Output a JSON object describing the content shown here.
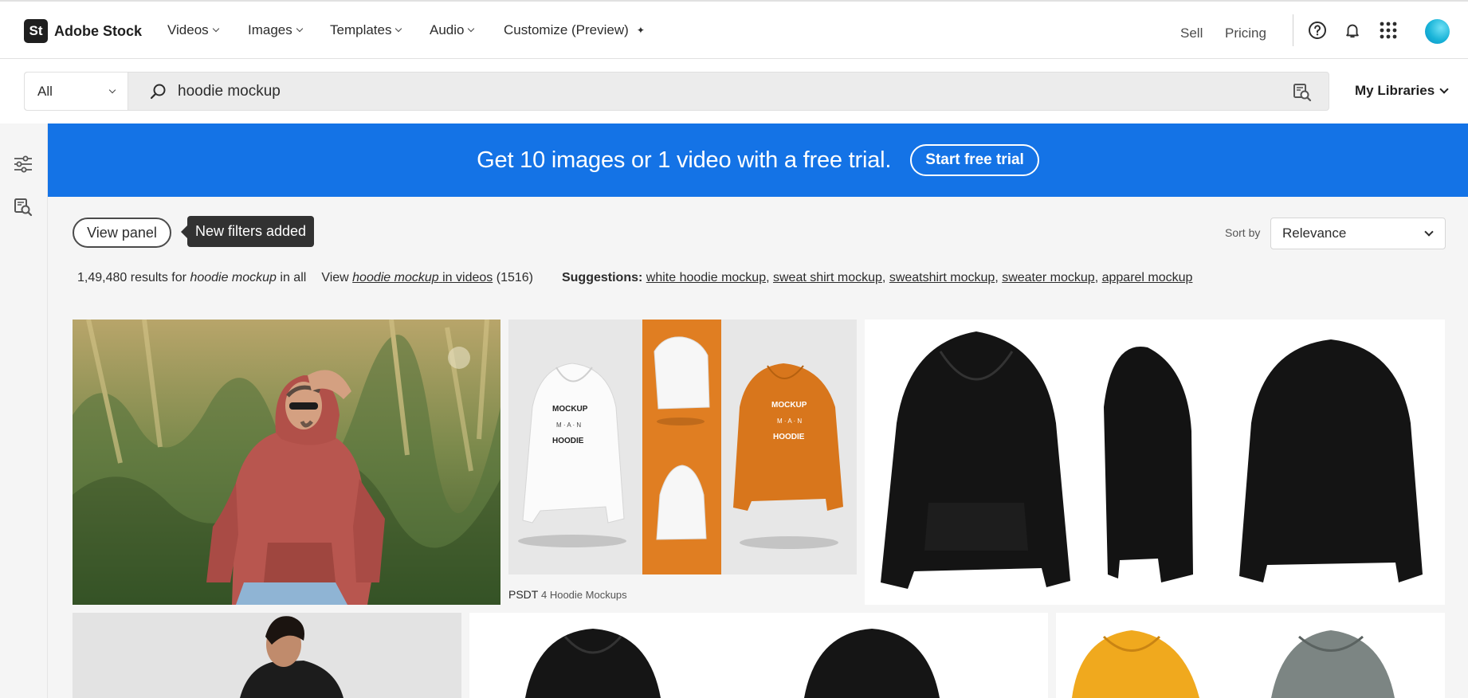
{
  "brand": {
    "mark": "St",
    "name": "Adobe Stock"
  },
  "nav": [
    {
      "label": "Videos"
    },
    {
      "label": "Images"
    },
    {
      "label": "Templates"
    },
    {
      "label": "Audio"
    },
    {
      "label": "Customize (Preview)"
    }
  ],
  "header_right": {
    "sell": "Sell",
    "pricing": "Pricing"
  },
  "icons": [
    "help-icon",
    "bell-icon",
    "apps-grid-icon",
    "avatar",
    "search-icon",
    "visual-search-icon",
    "filters-icon"
  ],
  "search": {
    "scope": "All",
    "query": "hoodie mockup",
    "libraries": "My Libraries"
  },
  "banner": {
    "text": "Get 10 images or 1 video with a free trial.",
    "cta": "Start free trial",
    "color": "#1473e6"
  },
  "toolbar": {
    "view_panel": "View panel",
    "tooltip": "New filters added",
    "sort_label": "Sort by",
    "sort_value": "Relevance"
  },
  "results": {
    "count": "1,49,480",
    "text_for": "results for",
    "query": "hoodie mockup",
    "text_in": "in all",
    "view": "View",
    "video_query": "hoodie mockup",
    "video_in": "in videos",
    "video_count": "(1516)",
    "suggestions_label": "Suggestions:",
    "suggestions": [
      "white hoodie mockup",
      "sweat shirt mockup",
      "sweatshirt mockup",
      "sweater mockup",
      "apparel mockup"
    ]
  },
  "tiles": [
    {
      "caption_badge": "PSDT",
      "caption_text": "4 Hoodie Mockups"
    }
  ],
  "colors": {
    "banner": "#1473e6",
    "tooltip": "#323232",
    "orange": "#e07e22"
  }
}
